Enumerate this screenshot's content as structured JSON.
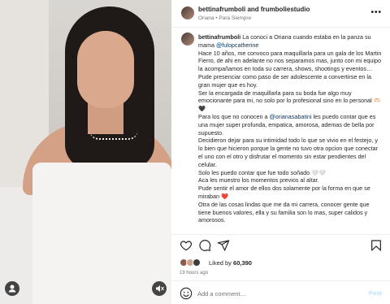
{
  "header": {
    "title": "bettinafrumboli and frumboliestudio",
    "subtitle": "Oriana • Para Siempre",
    "more_icon": "more-horizontal-icon"
  },
  "caption": {
    "username": "bettinafrumboli",
    "lines": [
      {
        "id": "l0",
        "segments": [
          {
            "text": "",
            "style": "user-spacer"
          },
          {
            "text": " La conoci a Oriana cuando estaba en la panza su mama ",
            "style": "plain"
          },
          {
            "text": "@fulopcatherine",
            "style": "link"
          }
        ]
      },
      {
        "id": "l1",
        "segments": [
          {
            "text": "Hace 10 años, me convoco para maquillarla para un gala de los Martin Fierro, de ahi en adelante no nos separamos mas, junto con mi equipo la acompañamos en toda su carrera, shows, shootings y eventos…",
            "style": "plain"
          }
        ]
      },
      {
        "id": "l2",
        "segments": [
          {
            "text": "Pude presenciar como paso de ser adolescente a convertirse en la gran mujer que es hoy.",
            "style": "plain"
          }
        ]
      },
      {
        "id": "l3",
        "segments": [
          {
            "text": "Ser la encargada de maquillarla para su boda fue algo muy emocionante para mi, no solo por lo profesional sino en lo personal 🫶🏻🖤",
            "style": "plain"
          }
        ]
      },
      {
        "id": "l4",
        "segments": [
          {
            "text": "Para los que no conocen a ",
            "style": "plain"
          },
          {
            "text": "@orianasabatini",
            "style": "link"
          },
          {
            "text": " les puedo contar que es una mujer super profunda, empatica, amorosa, ademas de bella por supuesto.",
            "style": "plain"
          }
        ]
      },
      {
        "id": "l5",
        "segments": [
          {
            "text": "Decidieron dejar para su intimidad todo lo que se vivio en el festejo, y lo bien que hicieron porque la gente no tuvo otra opcion que conectar el uno con el otro y disfrutar el momento sin estar pendientes del celular.",
            "style": "plain"
          }
        ]
      },
      {
        "id": "l6",
        "segments": [
          {
            "text": "Solo les puedo contar que fue todo soñado 🤍🤍",
            "style": "plain"
          }
        ]
      },
      {
        "id": "l7",
        "segments": [
          {
            "text": "Aca les muestro los momentos previos al altar.",
            "style": "plain"
          }
        ]
      },
      {
        "id": "l8",
        "segments": [
          {
            "text": "Pude sentir el amor de ellos dos solamente por la forma en que se miraban ❤️",
            "style": "plain"
          }
        ]
      },
      {
        "id": "l9",
        "segments": [
          {
            "text": "Otra de las cosas lindas que me da mi carrera, conocer gente que tiene buenos valores, ella y su familia son lo mas, super calidos y amorosos.",
            "style": "plain"
          }
        ]
      }
    ]
  },
  "actions": {
    "like_icon": "heart-icon",
    "comment_icon": "comment-icon",
    "share_icon": "share-icon",
    "save_icon": "bookmark-icon"
  },
  "likes": {
    "prefix": "Liked by",
    "count": "60,390"
  },
  "time": "19 hours ago",
  "comment": {
    "emoji_icon": "emoji-icon",
    "placeholder": "Add a comment…",
    "post_label": "Post"
  },
  "media": {
    "user_icon": "user-tag-icon",
    "mute_icon": "mute-icon"
  },
  "colors": {
    "link": "#00376b",
    "muted": "#737373",
    "post_disabled": "#c0dffd",
    "heart": "#e0245e"
  }
}
